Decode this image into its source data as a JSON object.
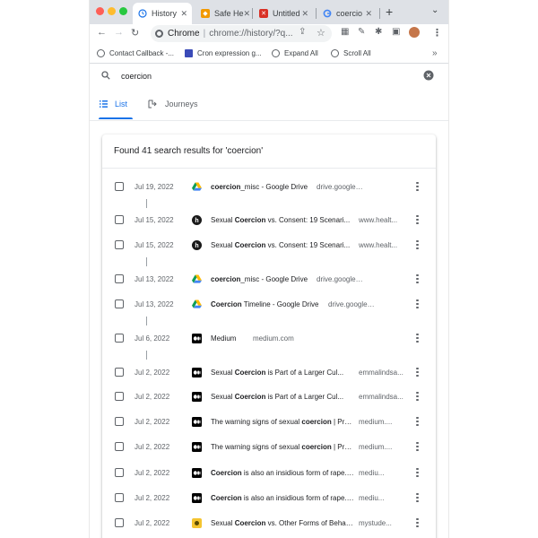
{
  "browser": {
    "tabs": [
      {
        "label": "History",
        "active": true
      },
      {
        "label": "Safe He",
        "active": false
      },
      {
        "label": "Untitled",
        "active": false
      },
      {
        "label": "coercio",
        "active": false
      }
    ],
    "omnibox": {
      "site": "Chrome",
      "url": "chrome://history/?q..."
    },
    "bookmarks": [
      {
        "label": "Contact Callback -..."
      },
      {
        "label": "Cron expression g..."
      },
      {
        "label": "Expand All"
      },
      {
        "label": "Scroll All"
      }
    ],
    "bookmarks_more": "»"
  },
  "history": {
    "search_value": "coercion",
    "tab_list": "List",
    "tab_journeys": "Journeys",
    "results_header": "Found 41 search results for 'coercion'",
    "rows": [
      {
        "date": "Jul 19, 2022",
        "title_bold": "coercion",
        "title_rest": "_misc - Google Drive",
        "title_pre": "",
        "domain": "drive.google.com",
        "favicon": "drive"
      },
      {
        "date": "Jul 15, 2022",
        "title_pre": "Sexual ",
        "title_bold": "Coercion",
        "title_rest": " vs. Consent: 19 Scenari...",
        "domain": "www.healt...",
        "favicon": "healthline"
      },
      {
        "date": "Jul 15, 2022",
        "title_pre": "Sexual ",
        "title_bold": "Coercion",
        "title_rest": " vs. Consent: 19 Scenari...",
        "domain": "www.healt...",
        "favicon": "healthline"
      },
      {
        "date": "Jul 13, 2022",
        "title_pre": "",
        "title_bold": "coercion",
        "title_rest": "_misc - Google Drive",
        "domain": "drive.google.com",
        "favicon": "drive"
      },
      {
        "date": "Jul 13, 2022",
        "title_pre": "",
        "title_bold": "Coercion",
        "title_rest": " Timeline - Google Drive",
        "domain": "drive.google.com",
        "favicon": "drive"
      },
      {
        "date": "Jul 6, 2022",
        "title_pre": "Medium",
        "title_bold": "",
        "title_rest": "",
        "domain": "medium.com",
        "favicon": "medium"
      },
      {
        "date": "Jul 2, 2022",
        "title_pre": "Sexual ",
        "title_bold": "Coercion",
        "title_rest": " is Part of a Larger Cul...",
        "domain": "emmalindsa...",
        "favicon": "medium"
      },
      {
        "date": "Jul 2, 2022",
        "title_pre": "Sexual ",
        "title_bold": "Coercion",
        "title_rest": " is Part of a Larger Cul...",
        "domain": "emmalindsa...",
        "favicon": "medium"
      },
      {
        "date": "Jul 2, 2022",
        "title_pre": "The warning signs of sexual ",
        "title_bold": "coercion",
        "title_rest": " | Pra...",
        "domain": "medium....",
        "favicon": "medium"
      },
      {
        "date": "Jul 2, 2022",
        "title_pre": "The warning signs of sexual ",
        "title_bold": "coercion",
        "title_rest": " | Pra...",
        "domain": "medium....",
        "favicon": "medium"
      },
      {
        "date": "Jul 2, 2022",
        "title_pre": "",
        "title_bold": "Coercion",
        "title_rest": " is also an insidious form of rape. | ...",
        "domain": "mediu...",
        "favicon": "medium"
      },
      {
        "date": "Jul 2, 2022",
        "title_pre": "",
        "title_bold": "Coercion",
        "title_rest": " is also an insidious form of rape. | ...",
        "domain": "mediu...",
        "favicon": "medium"
      },
      {
        "date": "Jul 2, 2022",
        "title_pre": "Sexual ",
        "title_bold": "Coercion",
        "title_rest": " vs. Other Forms of Behavi...",
        "domain": "mystude...",
        "favicon": "mystudent"
      }
    ]
  },
  "colors": {
    "accent": "#1a73e8",
    "tabstrip": "#dee1e6"
  }
}
